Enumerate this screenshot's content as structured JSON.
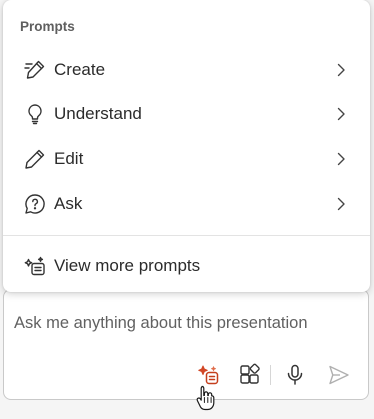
{
  "menu": {
    "heading": "Prompts",
    "items": [
      {
        "label": "Create",
        "icon": "pen-sparkle-icon"
      },
      {
        "label": "Understand",
        "icon": "lightbulb-icon"
      },
      {
        "label": "Edit",
        "icon": "pencil-icon"
      },
      {
        "label": "Ask",
        "icon": "chat-question-icon"
      }
    ],
    "view_more_label": "View more prompts"
  },
  "composer": {
    "placeholder": "Ask me anything about this presentation",
    "tools": [
      "prompt-guide-sparkle-icon",
      "apps-icon",
      "microphone-icon",
      "send-icon"
    ]
  },
  "colors": {
    "accent": "#c43e1c",
    "text": "#2b2b2b",
    "muted": "#5f5f5f"
  }
}
